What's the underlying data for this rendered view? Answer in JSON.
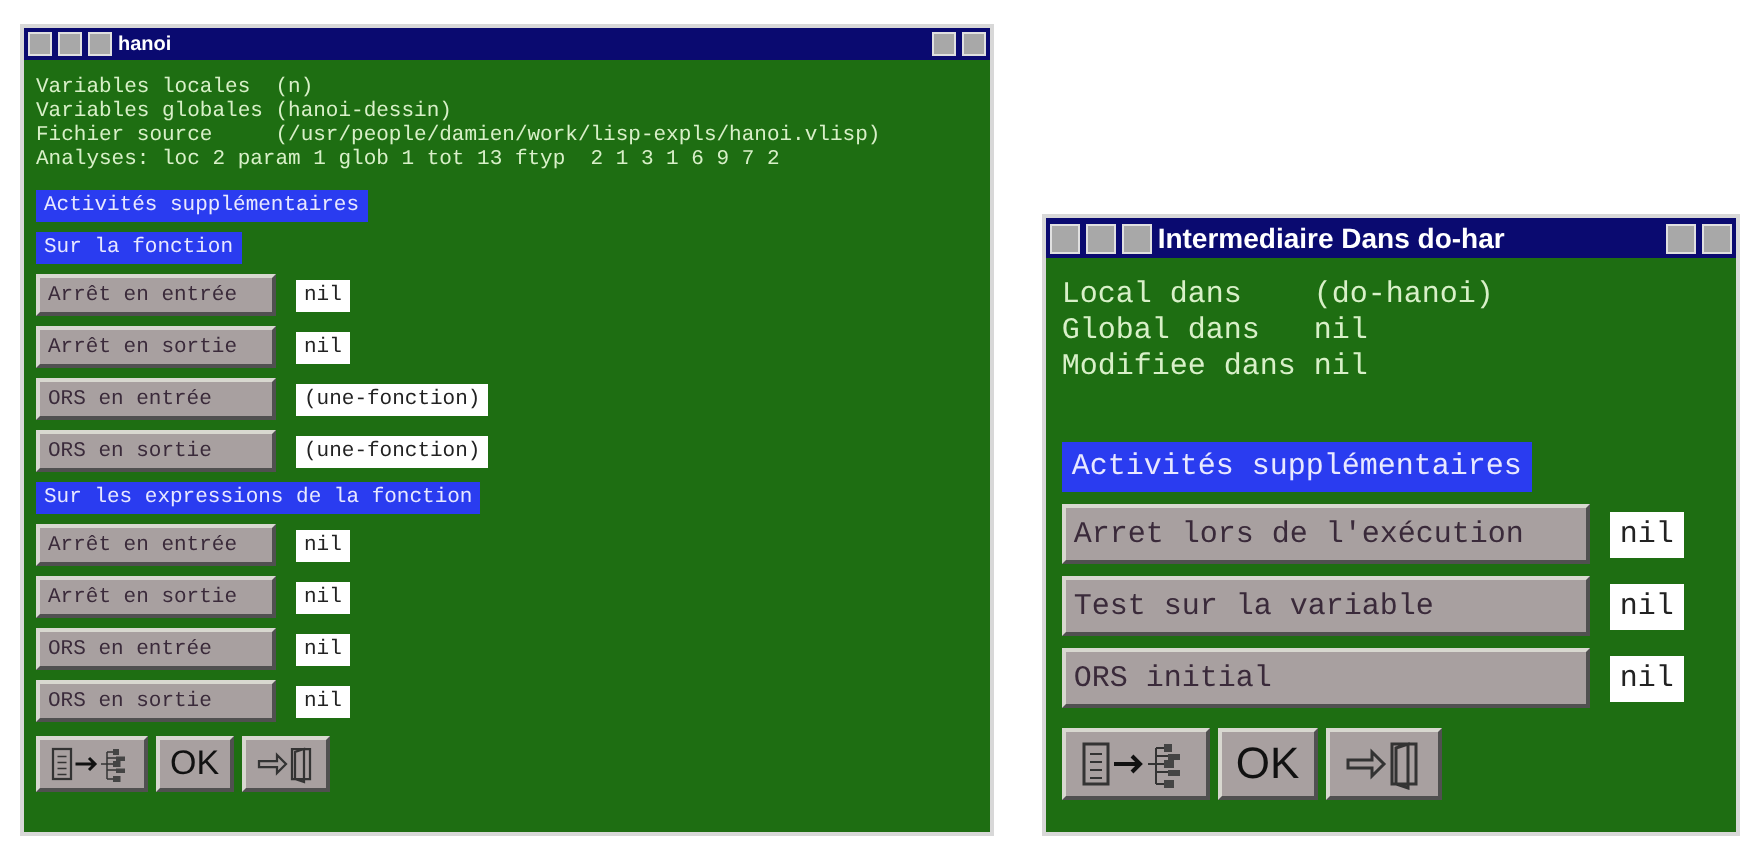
{
  "windows": [
    {
      "title": "hanoi",
      "kind": "compact",
      "info_lines": [
        "Variables locales  (n)",
        "Variables globales (hanoi-dessin)",
        "Fichier source     (/usr/people/damien/work/lisp-expls/hanoi.vlisp)",
        "Analyses: loc 2 param 1 glob 1 tot 13 ftyp  2 1 3 1 6 9 7 2"
      ],
      "activities_heading": "Activités supplémentaires",
      "groups": [
        {
          "heading": "Sur la fonction",
          "rows": [
            {
              "label": "Arrêt en entrée",
              "value": "nil"
            },
            {
              "label": "Arrêt en sortie",
              "value": "nil"
            },
            {
              "label": "ORS en entrée",
              "value": "(une-fonction)"
            },
            {
              "label": "ORS en sortie",
              "value": "(une-fonction)"
            }
          ]
        },
        {
          "heading": "Sur les expressions de la fonction",
          "rows": [
            {
              "label": "Arrêt en entrée",
              "value": "nil"
            },
            {
              "label": "Arrêt en sortie",
              "value": "nil"
            },
            {
              "label": "ORS en entrée",
              "value": "nil"
            },
            {
              "label": "ORS en sortie",
              "value": "nil"
            }
          ]
        }
      ],
      "buttons": [
        {
          "kind": "tree"
        },
        {
          "kind": "text",
          "label": "OK"
        },
        {
          "kind": "exit"
        }
      ]
    },
    {
      "title": "Intermediaire Dans do-har",
      "kind": "wide",
      "info_lines": [
        "Local dans    (do-hanoi)",
        "Global dans   nil",
        "Modifiee dans nil"
      ],
      "activities_heading": "Activités supplémentaires",
      "groups": [
        {
          "rows": [
            {
              "label": "Arret lors de l'exécution",
              "value": "nil"
            },
            {
              "label": "Test sur la variable",
              "value": "nil"
            },
            {
              "label": "ORS initial",
              "value": "nil"
            }
          ]
        }
      ],
      "buttons": [
        {
          "kind": "tree"
        },
        {
          "kind": "text",
          "label": "OK"
        },
        {
          "kind": "exit"
        }
      ]
    }
  ]
}
